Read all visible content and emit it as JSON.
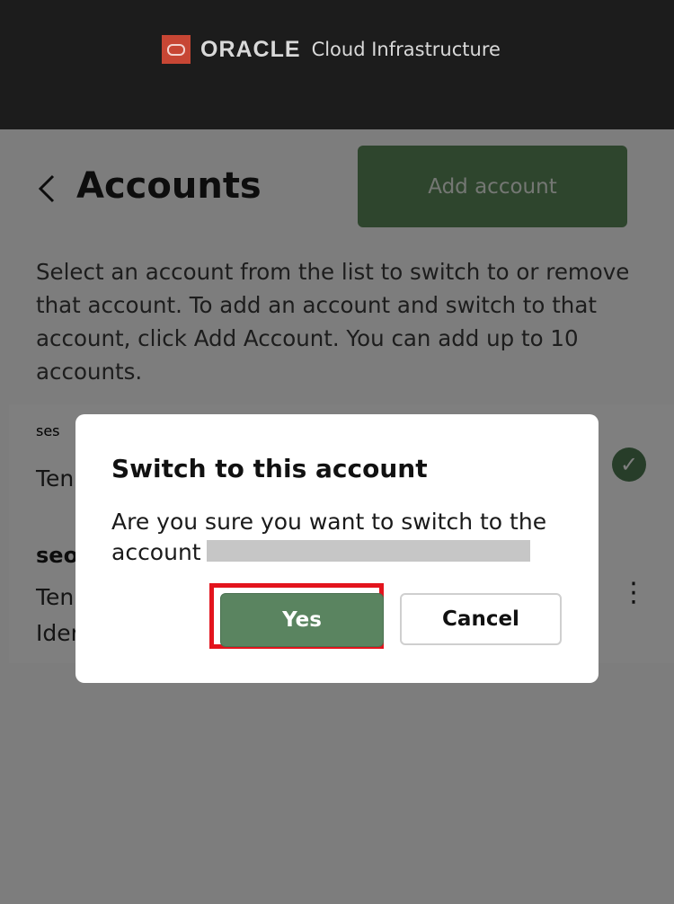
{
  "header": {
    "brand_name": "ORACLE",
    "brand_sub": "Cloud Infrastructure",
    "brand_color": "#c74634"
  },
  "page": {
    "back_icon": "chevron-left-icon",
    "title": "Accounts",
    "add_button_label": "Add account",
    "description": "Select an account from the list to switch to or remove that account. To add an account and switch to that account, click Add Account. You can add up to 10 accounts."
  },
  "accounts": [
    {
      "name_partial": "ses",
      "line1_partial": "Ten",
      "status_icon": "check-circle-icon"
    },
    {
      "name_partial": "seo",
      "line1_partial": "Ten",
      "line2_partial": "Ider",
      "menu_icon": "more-vertical-icon"
    }
  ],
  "dialog": {
    "title": "Switch to this account",
    "body_prefix": "Are you sure you want to switch to the account",
    "yes_label": "Yes",
    "cancel_label": "Cancel",
    "primary_color": "#5a8460",
    "highlight_color": "#e3141d"
  }
}
